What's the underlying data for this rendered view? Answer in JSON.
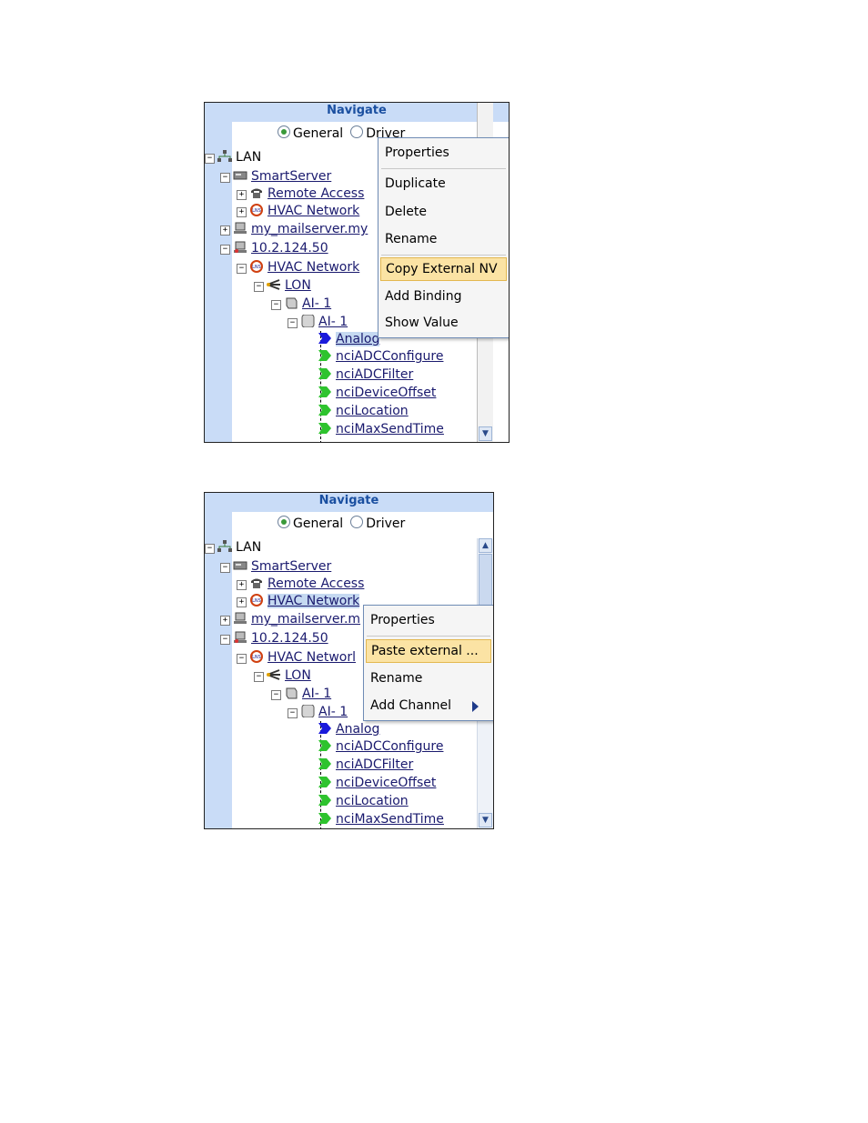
{
  "panel1": {
    "header": "Navigate",
    "radio_general": "General",
    "radio_driver": "Driver",
    "tree": {
      "lan": "LAN",
      "smartserver": "SmartServer",
      "remote_access": "Remote Access",
      "hvac_network_1": "HVAC Network",
      "mailserver": "my_mailserver.my",
      "ip": "10.2.124.50",
      "hvac_network_2": "HVAC Network",
      "lon": "LON",
      "ai1_device": "AI- 1",
      "ai1_block": "AI- 1",
      "analog": "Analog",
      "nv1": "nciADCConfigure",
      "nv2": "nciADCFilter",
      "nv3": "nciDeviceOffset",
      "nv4": "nciLocation",
      "nv5": "nciMaxSendTime"
    },
    "menu": {
      "properties": "Properties",
      "duplicate": "Duplicate",
      "delete": "Delete",
      "rename": "Rename",
      "copy_external_nv": "Copy External NV",
      "add_binding": "Add Binding",
      "show_value": "Show Value"
    }
  },
  "panel2": {
    "header": "Navigate",
    "radio_general": "General",
    "radio_driver": "Driver",
    "tree": {
      "lan": "LAN",
      "smartserver": "SmartServer",
      "remote_access": "Remote Access",
      "hvac_network_1": "HVAC Network",
      "mailserver": "my_mailserver.m",
      "ip": "10.2.124.50",
      "hvac_network_2": "HVAC Networl",
      "lon": "LON",
      "ai1_device": "AI- 1",
      "ai1_block": "AI- 1",
      "analog": "Analog",
      "nv1": "nciADCConfigure",
      "nv2": "nciADCFilter",
      "nv3": "nciDeviceOffset",
      "nv4": "nciLocation",
      "nv5": "nciMaxSendTime"
    },
    "menu": {
      "properties": "Properties",
      "paste_external": "Paste external ...",
      "rename": "Rename",
      "add_channel": "Add Channel"
    }
  },
  "tree_glyphs": {
    "expand": "+",
    "collapse": "−"
  },
  "colors": {
    "header_bg": "#c9dcf7",
    "menu_highlight": "#fbe3a4",
    "nv_input_flag": "#1a1adb",
    "nv_output_flag": "#2ec32e"
  },
  "icons": [
    "lan-icon",
    "server-icon",
    "phone-icon",
    "lns-icon",
    "computer-icon",
    "lon-channel-icon",
    "device-icon",
    "block-icon",
    "nv-flag-icon"
  ]
}
